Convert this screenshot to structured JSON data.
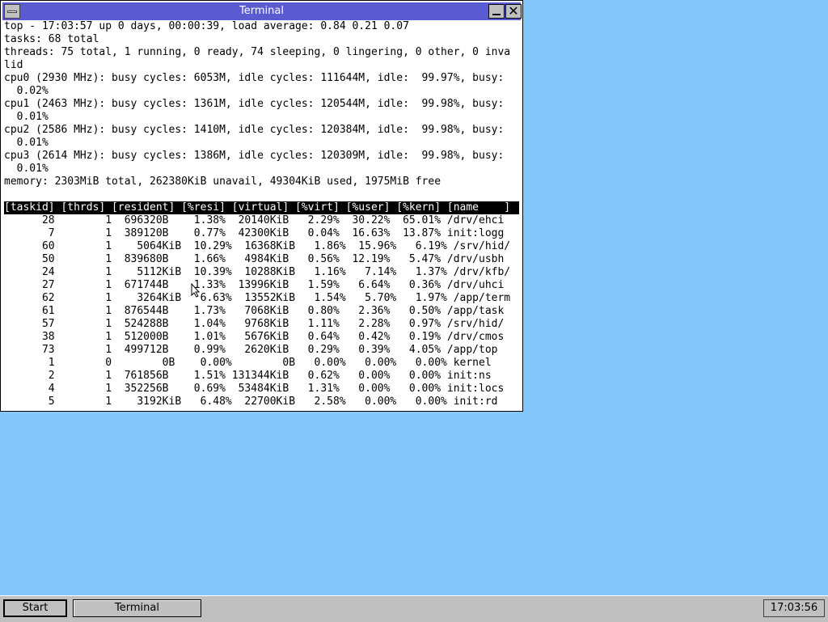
{
  "window": {
    "title": "Terminal"
  },
  "terminal": {
    "header_lines": [
      "top - 17:03:57 up 0 days, 00:00:39, load average: 0.84 0.21 0.07",
      "tasks: 68 total",
      "threads: 75 total, 1 running, 0 ready, 74 sleeping, 0 lingering, 0 other, 0 inva",
      "lid",
      "cpu0 (2930 MHz): busy cycles: 6053M, idle cycles: 111644M, idle:  99.97%, busy:",
      "  0.02%",
      "cpu1 (2463 MHz): busy cycles: 1361M, idle cycles: 120544M, idle:  99.98%, busy:",
      "  0.01%",
      "cpu2 (2586 MHz): busy cycles: 1410M, idle cycles: 120384M, idle:  99.98%, busy:",
      "  0.01%",
      "cpu3 (2614 MHz): busy cycles: 1386M, idle cycles: 120309M, idle:  99.98%, busy:",
      "  0.01%",
      "memory: 2303MiB total, 262380KiB unavail, 49304KiB used, 1975MiB free",
      ""
    ],
    "table_header": "[taskid] [thrds] [resident] [%resi] [virtual] [%virt] [%user] [%kern] [name    ]",
    "rows": [
      "      28        1  696320B    1.38%  20140KiB   2.29%  30.22%  65.01% /drv/ehci",
      "       7        1  389120B    0.77%  42300KiB   0.04%  16.63%  13.87% init:logg",
      "      60        1    5064KiB  10.29%  16368KiB   1.86%  15.96%   6.19% /srv/hid/",
      "      50        1  839680B    1.66%   4984KiB   0.56%  12.19%   5.47% /drv/usbh",
      "      24        1    5112KiB  10.39%  10288KiB   1.16%   7.14%   1.37% /drv/kfb/",
      "      27        1  671744B    1.33%  13996KiB   1.59%   6.64%   0.36% /drv/uhci",
      "      62        1    3264KiB   6.63%  13552KiB   1.54%   5.70%   1.97% /app/term",
      "      61        1  876544B    1.73%   7068KiB   0.80%   2.36%   0.50% /app/task",
      "      57        1  524288B    1.04%   9768KiB   1.11%   2.28%   0.97% /srv/hid/",
      "      38        1  512000B    1.01%   5676KiB   0.64%   0.42%   0.19% /drv/cmos",
      "      73        1  499712B    0.99%   2620KiB   0.29%   0.39%   4.05% /app/top",
      "       1        0        0B    0.00%        0B   0.00%   0.00%   0.00% kernel",
      "       2        1  761856B    1.51% 131344KiB   0.62%   0.00%   0.00% init:ns",
      "       4        1  352256B    0.69%  53484KiB   1.31%   0.00%   0.00% init:locs",
      "       5        1    3192KiB   6.48%  22700KiB   2.58%   0.00%   0.00% init:rd"
    ]
  },
  "taskbar": {
    "start_label": "Start",
    "task_label": "Terminal",
    "clock": "17:03:56"
  },
  "colors": {
    "desktop": "#84c7fb",
    "titlebar": "#5a5ad1"
  }
}
